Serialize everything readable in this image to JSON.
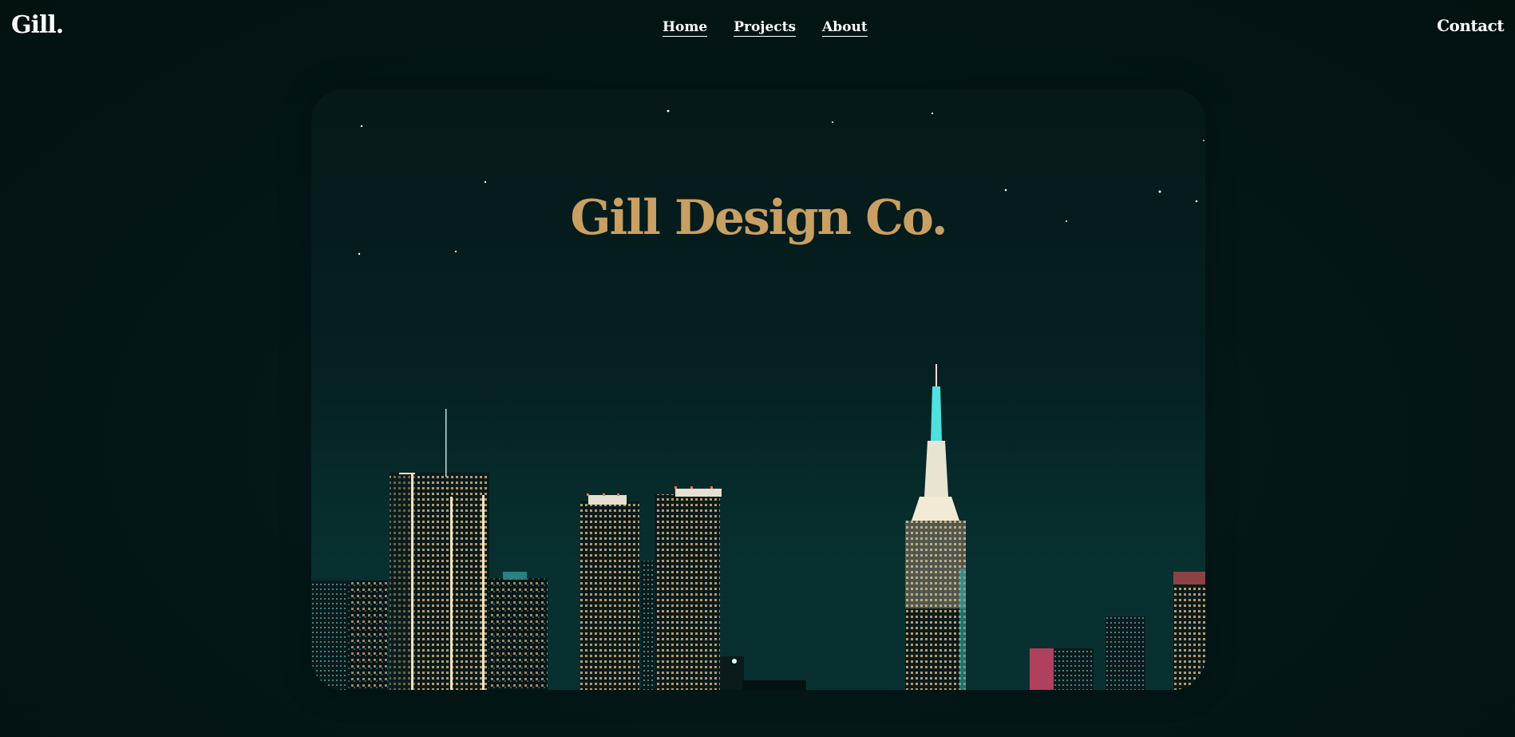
{
  "header": {
    "logo": "Gill.",
    "nav": [
      {
        "label": "Home"
      },
      {
        "label": "Projects"
      },
      {
        "label": "About"
      }
    ],
    "contact_label": "Contact"
  },
  "hero": {
    "title": "Gill Design Co.",
    "image_subject": "night-city-skyline",
    "title_color": "#c9a063",
    "background_color": "#041414"
  }
}
